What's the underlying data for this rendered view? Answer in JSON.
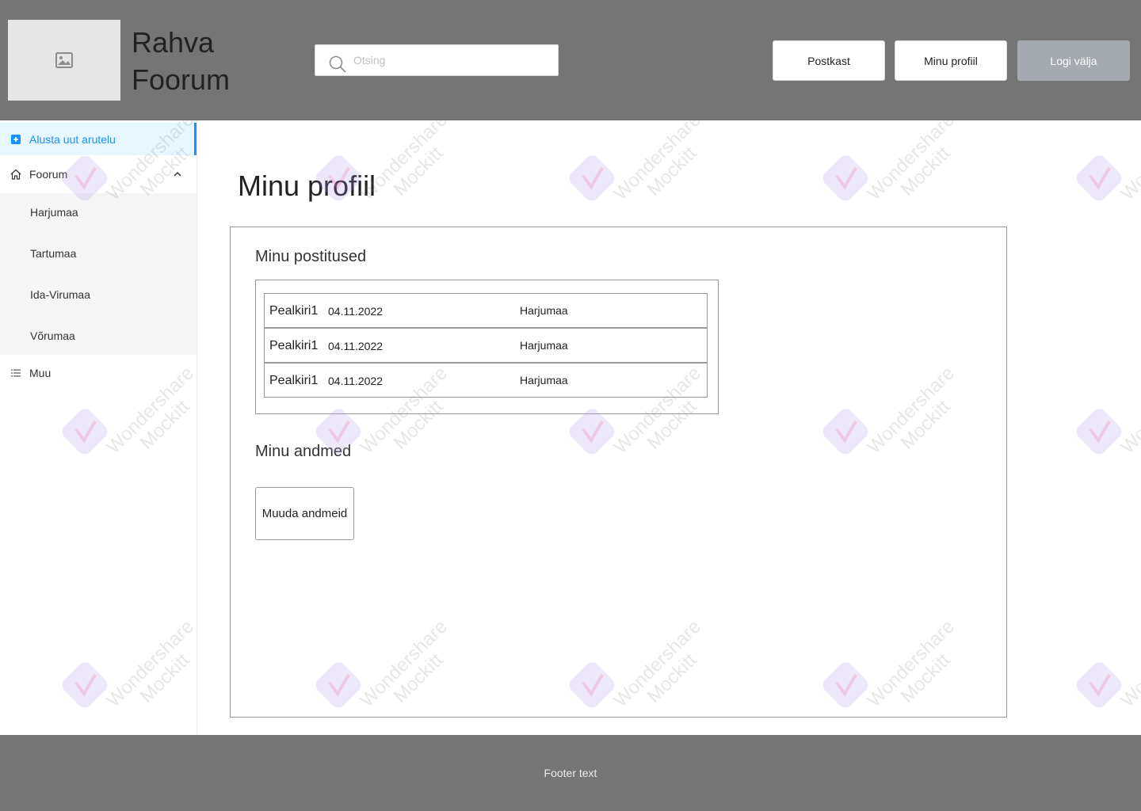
{
  "header": {
    "logo_icon": "image-icon",
    "title_line1": "Rahva",
    "title_line2": "Foorum",
    "search": {
      "placeholder": "Otsing",
      "icon": "search-icon"
    },
    "buttons": {
      "inbox": "Postkast",
      "profile": "Minu profiil",
      "logout": "Logi välja"
    }
  },
  "sidebar": {
    "new_discussion": {
      "label": "Alusta uut arutelu",
      "icon": "plus-square-icon"
    },
    "forum": {
      "label": "Foorum",
      "icon": "home-icon",
      "expanded": true
    },
    "regions": [
      "Harjumaa",
      "Tartumaa",
      "Ida-Virumaa",
      "Võrumaa"
    ],
    "other": {
      "label": "Muu",
      "icon": "list-icon"
    }
  },
  "main": {
    "title": "Minu profiil",
    "posts_heading": "Minu postitused",
    "posts": [
      {
        "title": "Pealkiri1",
        "date": "04.11.2022",
        "category": "Harjumaa"
      },
      {
        "title": "Pealkiri1",
        "date": "04.11.2022",
        "category": "Harjumaa"
      },
      {
        "title": "Pealkiri1",
        "date": "04.11.2022",
        "category": "Harjumaa"
      }
    ],
    "data_heading": "Minu andmed",
    "edit_button": "Muuda andmeid"
  },
  "footer": {
    "text": "Footer text"
  },
  "watermark": {
    "line1": "Wondershare",
    "line2": "Mockitt"
  },
  "colors": {
    "header_bg": "#757575",
    "accent": "#1890ff",
    "active_bg": "#e6f7ff",
    "logout_bg": "#a4aab0"
  }
}
